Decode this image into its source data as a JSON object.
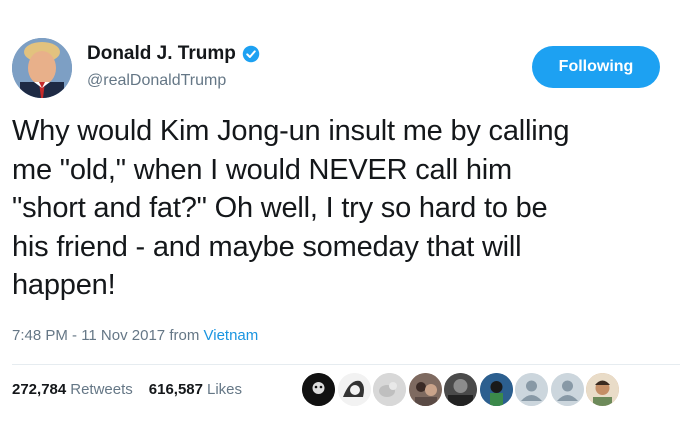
{
  "author": {
    "name": "Donald J. Trump",
    "handle": "@realDonaldTrump",
    "avatar_icon": "profile-photo",
    "verified": true
  },
  "follow_button": {
    "label": "Following"
  },
  "tweet": {
    "lines": [
      "Why would Kim Jong-un insult me by calling",
      "me \"old,\" when I would NEVER call him",
      "\"short and fat?\" Oh well, I try so hard to be",
      "his friend - and maybe someday that will",
      "happen!"
    ]
  },
  "meta": {
    "time_date": "7:48 PM - 11 Nov 2017",
    "from_label": "from",
    "location": "Vietnam"
  },
  "stats": {
    "retweets_count": "272,784",
    "retweets_label": "Retweets",
    "likes_count": "616,587",
    "likes_label": "Likes"
  },
  "colors": {
    "accent": "#1da1f2",
    "link": "#1b95e0",
    "muted": "#657786"
  }
}
